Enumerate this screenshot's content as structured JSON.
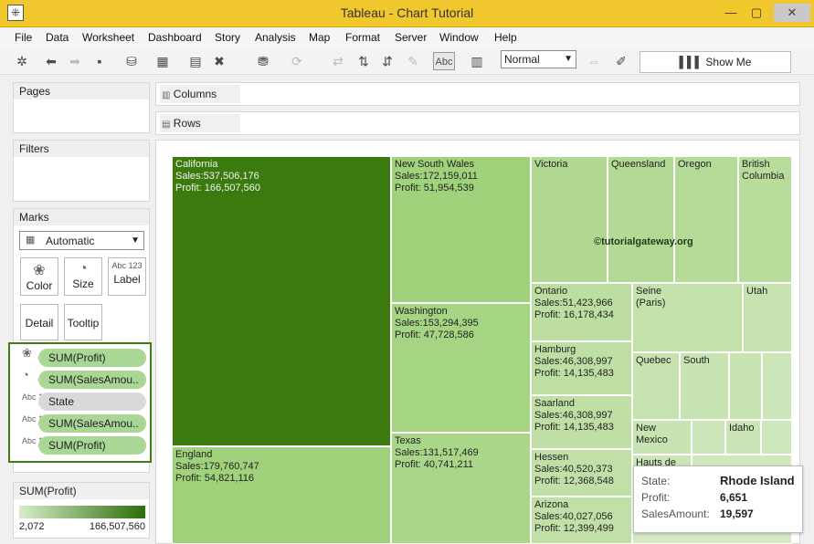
{
  "window": {
    "title": "Tableau - Chart Tutorial",
    "minimize": "—",
    "maximize": "▢",
    "close": "✕"
  },
  "menu": [
    "File",
    "Data",
    "Worksheet",
    "Dashboard",
    "Story",
    "Analysis",
    "Map",
    "Format",
    "Server",
    "Window",
    "Help"
  ],
  "toolbar": {
    "label_button": "Abc",
    "view_select": "Normal",
    "show_me": "Show Me",
    "icons": [
      "tableau-logo-icon",
      "back-arrow-icon",
      "forward-arrow-icon",
      "save-icon",
      "new-datasource-icon",
      "new-worksheet-icon",
      "duplicate-sheet-icon",
      "clear-sheet-icon",
      "pause-updates-icon",
      "refresh-icon",
      "swap-icon",
      "sort-ascending-icon",
      "sort-descending-icon",
      "highlight-icon",
      "label-icon",
      "chart-type-icon",
      "fit-icon",
      "pen-icon",
      "bar-chart-icon"
    ]
  },
  "panels": {
    "pages": "Pages",
    "filters": "Filters",
    "marks": "Marks",
    "mark_type": "Automatic",
    "buttons": {
      "color": "Color",
      "size": "Size",
      "label": "Label",
      "detail": "Detail",
      "tooltip": "Tooltip"
    },
    "label_icon_text": "Abc 123",
    "pills": [
      {
        "icon": "color-icon",
        "text": "SUM(Profit)",
        "green": true
      },
      {
        "icon": "size-icon",
        "text": "SUM(SalesAmou..",
        "green": true
      },
      {
        "icon": "label-icon",
        "text": "State",
        "green": false
      },
      {
        "icon": "label-icon",
        "text": "SUM(SalesAmou..",
        "green": true
      },
      {
        "icon": "label-icon",
        "text": "SUM(Profit)",
        "green": true
      }
    ]
  },
  "shelves": {
    "columns": "Columns",
    "rows": "Rows"
  },
  "legend": {
    "title": "SUM(Profit)",
    "min": "2,072",
    "max": "166,507,560",
    "colors": [
      "#d6edc9",
      "#2d6d0b"
    ]
  },
  "chart_data": {
    "type": "treemap",
    "size_measure": "SUM(SalesAmount)",
    "color_measure": "SUM(Profit)",
    "cells": [
      {
        "state": "California",
        "sales": 537506176,
        "profit": 166507560,
        "lines": [
          "California",
          "Sales:537,506,176",
          "Profit: 166,507,560"
        ],
        "color": "#3b7a0f"
      },
      {
        "state": "England",
        "sales": 179760747,
        "profit": 54821116,
        "lines": [
          "England",
          "Sales:179,760,747",
          "Profit: 54,821,116"
        ],
        "color": "#9fd27a"
      },
      {
        "state": "New South Wales",
        "sales": 172159011,
        "profit": 51954539,
        "lines": [
          "New South Wales",
          "Sales:172,159,011",
          "Profit: 51,954,539"
        ],
        "color": "#a0d27c"
      },
      {
        "state": "Washington",
        "sales": 153294395,
        "profit": 47728586,
        "lines": [
          "Washington",
          "Sales:153,294,395",
          "Profit: 47,728,586"
        ],
        "color": "#a5d483"
      },
      {
        "state": "Texas",
        "sales": 131517469,
        "profit": 40741211,
        "lines": [
          "Texas",
          "Sales:131,517,469",
          "Profit: 40,741,211"
        ],
        "color": "#aad689"
      },
      {
        "state": "Victoria",
        "lines": [
          "Victoria"
        ],
        "color": "#b1d992"
      },
      {
        "state": "Queensland",
        "lines": [
          "Queensland"
        ],
        "color": "#b3da95"
      },
      {
        "state": "Oregon",
        "lines": [
          "Oregon"
        ],
        "color": "#b5db98"
      },
      {
        "state": "British Columbia",
        "lines": [
          "British",
          "Columbia"
        ],
        "color": "#b8dc9c"
      },
      {
        "state": "Ontario",
        "sales": 51423966,
        "profit": 16178434,
        "lines": [
          "Ontario",
          "Sales:51,423,966",
          "Profit: 16,178,434"
        ],
        "color": "#bcdea1"
      },
      {
        "state": "Seine (Paris)",
        "lines": [
          "Seine",
          "(Paris)"
        ],
        "color": "#c4e2ac"
      },
      {
        "state": "Utah",
        "lines": [
          "Utah"
        ],
        "color": "#c6e3af"
      },
      {
        "state": "Hamburg",
        "sales": 46308997,
        "profit": 14135483,
        "lines": [
          "Hamburg",
          "Sales:46,308,997",
          "Profit: 14,135,483"
        ],
        "color": "#bedfa4"
      },
      {
        "state": "Quebec",
        "lines": [
          "Quebec"
        ],
        "color": "#c6e3af"
      },
      {
        "state": "South",
        "lines": [
          "South"
        ],
        "color": "#c8e4b2"
      },
      {
        "state": "Saarland",
        "sales": 46308997,
        "profit": 14135483,
        "lines": [
          "Saarland",
          "Sales:46,308,997",
          "Profit: 14,135,483"
        ],
        "color": "#bfdfa5"
      },
      {
        "state": "New Mexico",
        "lines": [
          "New",
          "Mexico"
        ],
        "color": "#c8e4b2"
      },
      {
        "state": "Idaho",
        "lines": [
          "Idaho"
        ],
        "color": "#cbe5b6"
      },
      {
        "state": "Hessen",
        "sales": 40520373,
        "profit": 12368548,
        "lines": [
          "Hessen",
          "Sales:40,520,373",
          "Profit: 12,368,548"
        ],
        "color": "#c1e0a8"
      },
      {
        "state": "Hauts de Seine",
        "lines": [
          "Hauts de"
        ],
        "color": "#cbe5b6"
      },
      {
        "state": "Arizona",
        "sales": 40027056,
        "profit": 12399499,
        "lines": [
          "Arizona",
          "Sales:40,027,056",
          "Profit: 12,399,499"
        ],
        "color": "#c1e0a8"
      }
    ],
    "watermark": "©tutorialgateway.org",
    "tooltip": {
      "state_label": "State:",
      "state": "Rhode Island",
      "profit_label": "Profit:",
      "profit": "6,651",
      "sales_label": "SalesAmount:",
      "sales": "19,597"
    }
  }
}
